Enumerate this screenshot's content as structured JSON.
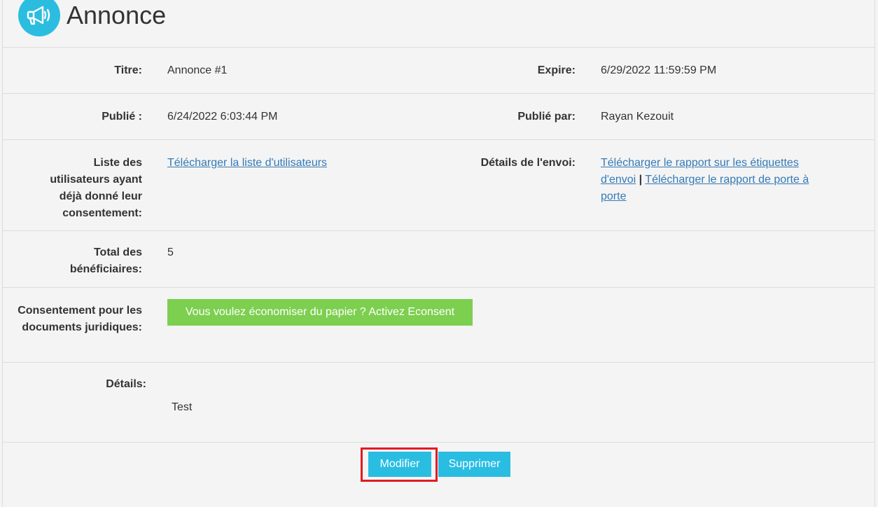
{
  "header": {
    "title": "Annonce",
    "icon": "megaphone-icon",
    "icon_color": "#2bbde0"
  },
  "fields": {
    "titre": {
      "label": "Titre:",
      "value": "Annonce #1"
    },
    "expire": {
      "label": "Expire:",
      "value": "6/29/2022 11:59:59 PM"
    },
    "publie": {
      "label": "Publié :",
      "value": "6/24/2022 6:03:44 PM"
    },
    "publie_par": {
      "label": "Publié par:",
      "value": "Rayan Kezouit"
    },
    "liste": {
      "label": "Liste des utilisateurs ayant déjà donné leur consentement:",
      "link": "Télécharger la liste d'utilisateurs"
    },
    "envoi": {
      "label": "Détails de l'envoi:",
      "link1": "Télécharger le rapport sur les étiquettes d'envoi",
      "separator": "|",
      "link2": "Télécharger le rapport de porte à porte"
    },
    "total": {
      "label": "Total des bénéficiaires:",
      "value": "5"
    },
    "consentement": {
      "label": "Consentement pour les documents juridiques:",
      "button": "Vous voulez économiser du papier ? Activez Econsent"
    },
    "details": {
      "label": "Détails:",
      "value": "Test"
    }
  },
  "actions": {
    "modifier": "Modifier",
    "supprimer": "Supprimer"
  },
  "colors": {
    "accent": "#29bde2",
    "econsent": "#7dcf4f",
    "link": "#337ab7",
    "highlight": "#e21b23"
  }
}
